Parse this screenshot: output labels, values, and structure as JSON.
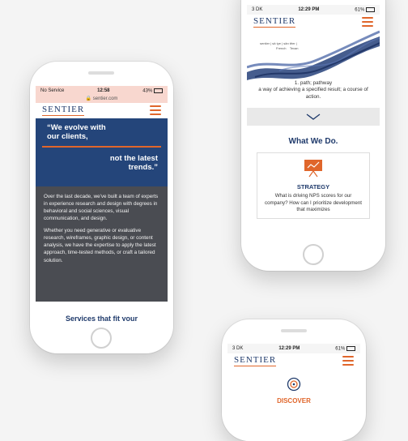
{
  "colors": {
    "navy": "#1f3a6b",
    "orange": "#e0662b",
    "status_pink": "#f8d7cf"
  },
  "phone_left": {
    "status": {
      "carrier": "No Service",
      "wifi": "wifi-icon",
      "time": "12:58",
      "battery": "43%"
    },
    "url": "sentier.com",
    "logo": "SENTIER",
    "quote_line1": "“We evolve with",
    "quote_line2": "our clients,",
    "quote_line3": "not the latest",
    "quote_line4": "trends.”",
    "para1": "Over the last decade, we've built a team of experts in experience research and design with degrees in behavioral and social sciences, visual communication, and design.",
    "para2": "Whether you need generative or evaluative research, wireframes, graphic design, or content analysis, we have the expertise to apply the latest approach, time-tested methods, or craft a tailored solution.",
    "services_heading": "Services that fit your"
  },
  "phone_top_right": {
    "status": {
      "carrier": "3 DK",
      "time": "12:29 PM",
      "battery": "61%"
    },
    "logo": "SENTIER",
    "pronunciation_word": "sentier",
    "pronunciation_phonetic": "| sä tye | sän tēer |",
    "pronunciation_langs": "French    Texan",
    "definition_line1": "1. path; pathway",
    "definition_line2": "a way of achieving a specified result; a course of action.",
    "what_we_do": "What We Do.",
    "strategy_title": "STRATEGY",
    "strategy_text": "What is driving NPS scores for our company? How can I prioritize development that maximizes"
  },
  "phone_bottom_right": {
    "status": {
      "carrier": "3 DK",
      "time": "12:29 PM",
      "battery": "61%"
    },
    "logo": "SENTIER",
    "discover_title": "DISCOVER"
  }
}
